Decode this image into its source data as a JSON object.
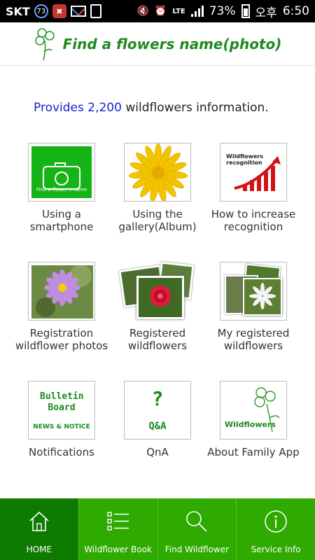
{
  "status_bar": {
    "carrier": "SKT",
    "badge": "73",
    "lte": "LTE",
    "battery": "73%",
    "ampm": "오후",
    "time": "6:50"
  },
  "header": {
    "title": "Find a flowers name(photo)"
  },
  "intro": {
    "highlight": "Provides 2,200",
    "rest": " wildflowers information."
  },
  "tiles": [
    {
      "label": "Using a smartphone",
      "image_title": "Find a flower's name"
    },
    {
      "label": "Using the gallery(Album)"
    },
    {
      "label": "How to increase recognition",
      "image_title": "Wildflowers recognition"
    },
    {
      "label": "Registration wildflower photos"
    },
    {
      "label": "Registered wildflowers"
    },
    {
      "label": "My registered wildflowers"
    },
    {
      "label": "Notifications",
      "image_title": "Bulletin Board",
      "image_sub": "NEWS & NOTICE"
    },
    {
      "label": "QnA",
      "image_title": "Q&A"
    },
    {
      "label": "About Family App",
      "image_title": "Wildflowers"
    }
  ],
  "nav": [
    {
      "label": "HOME",
      "icon": "home-icon"
    },
    {
      "label": "Wildflower Book",
      "icon": "list-icon"
    },
    {
      "label": "Find Wildflower",
      "icon": "search-icon"
    },
    {
      "label": "Service Info",
      "icon": "info-icon"
    }
  ],
  "colors": {
    "brand_green": "#2eaa00",
    "active_green": "#0d7a00",
    "title_green": "#1e8a1e",
    "highlight_blue": "#1a23c9"
  }
}
